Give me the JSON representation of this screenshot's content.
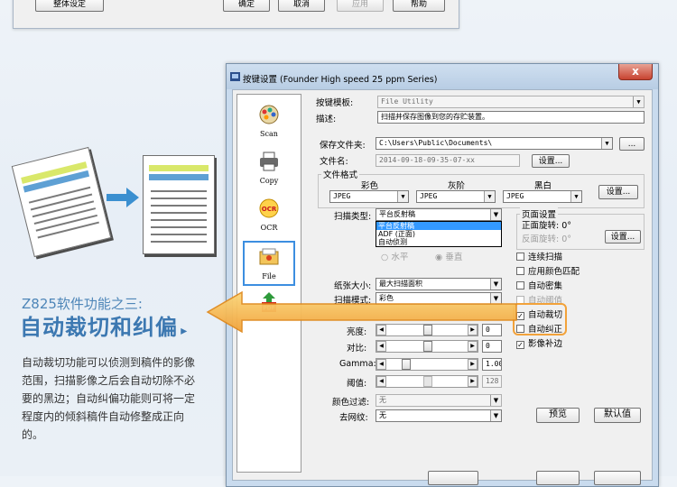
{
  "top_dialog": {
    "overall_settings": "整体设定",
    "ok": "确定",
    "cancel": "取消",
    "apply": "应用",
    "help": "帮助"
  },
  "illustration": {
    "arrow_color": "#3b8fd0",
    "band_yellow": "#d9e86a",
    "band_blue": "#5ea0d4"
  },
  "text": {
    "subtitle": "Z825软件功能之三:",
    "title": "自动裁切和纠偏",
    "title_arrow": "▸",
    "description": "自动裁切功能可以侦测到稿件的影像范围，扫描影像之后会自动切除不必要的黑边；自动纠偏功能则可将一定程度内的倾斜稿件自动修整成正向的。"
  },
  "window": {
    "title": "按键设置 (Founder High speed 25 ppm Series)",
    "close": "x",
    "sidebar": [
      {
        "label": "Scan",
        "icon": "scan-icon"
      },
      {
        "label": "Copy",
        "icon": "printer-icon"
      },
      {
        "label": "OCR",
        "icon": "ocr-icon"
      },
      {
        "label": "File",
        "icon": "file-icon",
        "selected": true
      },
      {
        "label": "",
        "icon": "pdf-icon"
      }
    ],
    "template_label": "按键模板:",
    "template_value": "File Utility",
    "desc_label": "描述:",
    "desc_value": "扫描并保存图像到您的存贮装置。",
    "save_folder_label": "保存文件夹:",
    "save_folder_value": "C:\\Users\\Public\\Documents\\",
    "browse": "...",
    "filename_label": "文件名:",
    "filename_value": "2014-09-18-09-35-07-xx",
    "filename_settings": "设置...",
    "format_group": "文件格式",
    "format_cols": [
      "彩色",
      "灰阶",
      "黑白"
    ],
    "format_values": [
      "JPEG",
      "JPEG",
      "JPEG"
    ],
    "format_settings": "设置...",
    "scan_type_label": "扫描类型:",
    "scan_type_value": "平台反射稿",
    "scan_type_options": [
      "平台反射稿",
      "ADF (正面)",
      "自动侦测"
    ],
    "orient_h": "水平",
    "orient_v": "垂直",
    "page_group": "页面设置",
    "rotate_front": "正面旋转: 0°",
    "rotate_back": "反面旋转: 0°",
    "page_settings": "设置...",
    "checks": [
      {
        "label": "连续扫描",
        "checked": false,
        "disabled": false
      },
      {
        "label": "应用颜色匹配",
        "checked": false,
        "disabled": false
      },
      {
        "label": "自动密集",
        "checked": false,
        "disabled": false
      },
      {
        "label": "自动阈值",
        "checked": false,
        "disabled": true
      },
      {
        "label": "自动裁切",
        "checked": true,
        "disabled": false
      },
      {
        "label": "自动纠正",
        "checked": false,
        "disabled": false
      },
      {
        "label": "影像补边",
        "checked": true,
        "disabled": false
      }
    ],
    "paper_size_label": "纸张大小:",
    "paper_size_value": "最大扫描面积",
    "scan_mode_label": "扫描模式:",
    "scan_mode_value": "彩色",
    "brightness_label": "亮度:",
    "brightness_value": "0",
    "contrast_label": "对比:",
    "contrast_value": "0",
    "gamma_label": "Gamma:",
    "gamma_value": "1.00",
    "threshold_label": "阈值:",
    "threshold_value": "128",
    "color_filter_label": "颜色过滤:",
    "color_filter_value": "无",
    "descreen_label": "去网纹:",
    "descreen_value": "无",
    "preview": "预览",
    "default": "默认值",
    "highlight_color": "#f2a23a"
  }
}
